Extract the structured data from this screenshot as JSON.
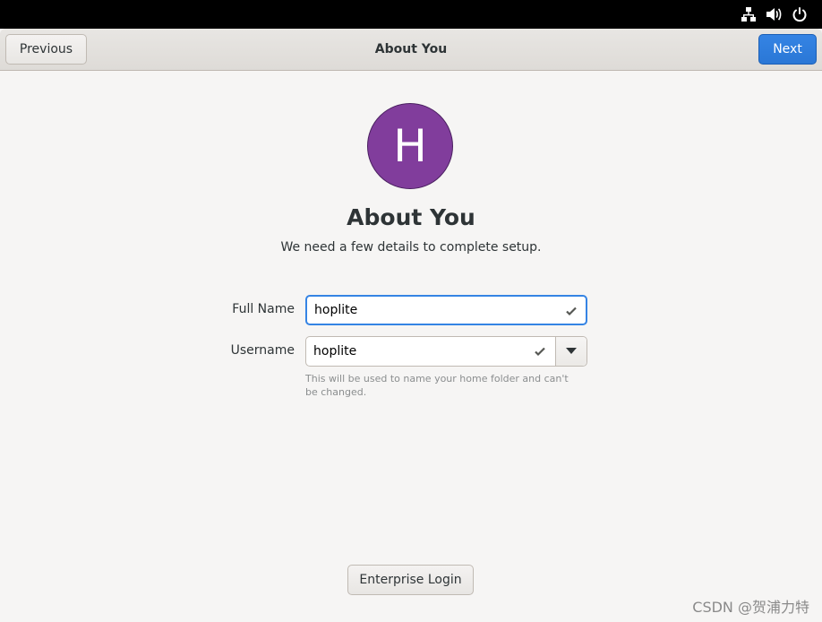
{
  "system_bar": {
    "icons": [
      "network-icon",
      "volume-icon",
      "power-icon"
    ]
  },
  "header": {
    "previous_label": "Previous",
    "title": "About You",
    "next_label": "Next"
  },
  "avatar": {
    "initial": "H",
    "color": "#813d9c"
  },
  "page": {
    "title": "About You",
    "subtitle": "We need a few details to complete setup."
  },
  "form": {
    "full_name_label": "Full Name",
    "full_name_value": "hoplite",
    "username_label": "Username",
    "username_value": "hoplite",
    "username_hint": "This will be used to name your home folder and can't be changed."
  },
  "footer": {
    "enterprise_login_label": "Enterprise Login"
  },
  "watermark": "CSDN @贺浦力特",
  "colors": {
    "accent": "#3584e4",
    "avatar": "#813d9c",
    "background": "#f6f5f4"
  }
}
